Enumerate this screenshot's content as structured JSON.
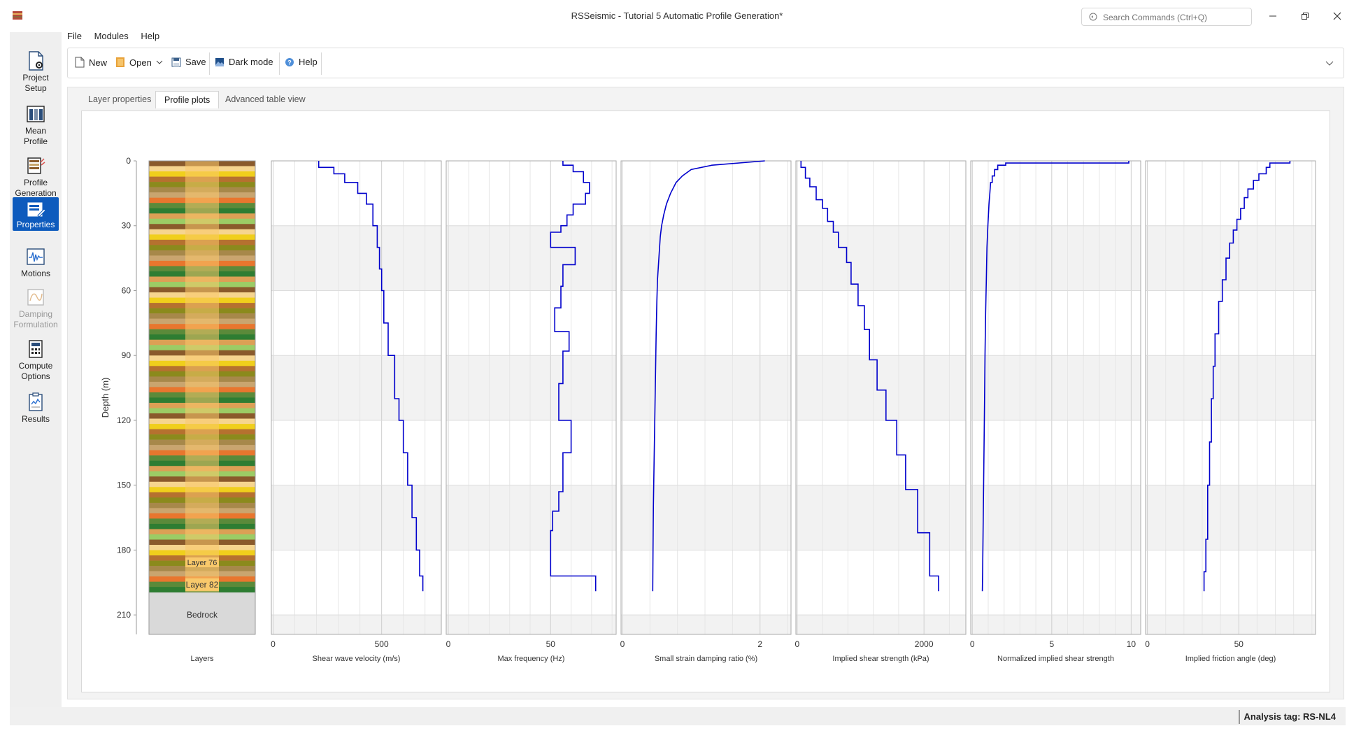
{
  "window": {
    "title": "RSSeismic - Tutorial 5 Automatic Profile Generation*"
  },
  "search": {
    "placeholder": "Search Commands (Ctrl+Q)"
  },
  "menu": [
    "File",
    "Modules",
    "Help"
  ],
  "toolbar": {
    "new_label": "New",
    "open_label": "Open",
    "save_label": "Save",
    "darkmode_label": "Dark mode",
    "help_label": "Help"
  },
  "sidebar": {
    "items": [
      {
        "line1": "Project",
        "line2": "Setup"
      },
      {
        "line1": "Mean",
        "line2": "Profile"
      },
      {
        "line1": "Profile",
        "line2": "Generation"
      },
      {
        "line1": "Properties",
        "line2": ""
      },
      {
        "line1": "Motions",
        "line2": ""
      },
      {
        "line1": "Damping",
        "line2": "Formulation"
      },
      {
        "line1": "Compute",
        "line2": "Options"
      },
      {
        "line1": "Results",
        "line2": ""
      }
    ]
  },
  "tabs": [
    "Layer properties",
    "Profile plots",
    "Advanced table view"
  ],
  "status": {
    "analysis_tag": "Analysis tag: RS-NL4"
  },
  "colors": {
    "accent": "#0e5bbd",
    "curve": "#0000cc",
    "band": "#f2f2f2",
    "bedrock": "#d9d9d9",
    "label_chip": "#f9c96b"
  },
  "chart_data": {
    "type": "line",
    "ylabel": "Depth (m)",
    "y_ticks": [
      0,
      30,
      60,
      90,
      120,
      150,
      180,
      210
    ],
    "ylim": [
      0,
      219
    ],
    "grid": true,
    "layers_panel": {
      "xlabel": "Layers",
      "visible_layer_labels": [
        "Layer 76",
        "Layer 82"
      ],
      "bedrock_label": "Bedrock",
      "bedrock_top_depth": 199.5,
      "layer_count": 82
    },
    "panels": [
      {
        "xlabel": "Shear wave velocity (m/s)",
        "xlim": [
          -8,
          775
        ],
        "x_ticks": [
          0,
          500
        ],
        "points": [
          [
            210,
            0
          ],
          [
            210,
            3
          ],
          [
            280,
            3
          ],
          [
            280,
            6
          ],
          [
            330,
            6
          ],
          [
            330,
            10
          ],
          [
            390,
            10
          ],
          [
            390,
            15
          ],
          [
            430,
            15
          ],
          [
            430,
            20
          ],
          [
            460,
            20
          ],
          [
            460,
            30
          ],
          [
            480,
            30
          ],
          [
            480,
            40
          ],
          [
            490,
            40
          ],
          [
            490,
            50
          ],
          [
            500,
            50
          ],
          [
            500,
            60
          ],
          [
            510,
            60
          ],
          [
            510,
            75
          ],
          [
            530,
            75
          ],
          [
            530,
            90
          ],
          [
            560,
            90
          ],
          [
            560,
            110
          ],
          [
            580,
            110
          ],
          [
            580,
            120
          ],
          [
            600,
            120
          ],
          [
            600,
            135
          ],
          [
            620,
            135
          ],
          [
            620,
            150
          ],
          [
            640,
            150
          ],
          [
            640,
            165
          ],
          [
            660,
            165
          ],
          [
            660,
            180
          ],
          [
            675,
            180
          ],
          [
            675,
            192
          ],
          [
            690,
            192
          ],
          [
            690,
            199
          ]
        ]
      },
      {
        "xlabel": "Max frequency (Hz)",
        "xlim": [
          -1,
          82
        ],
        "x_ticks": [
          0,
          50
        ],
        "points": [
          [
            56,
            0
          ],
          [
            56,
            2
          ],
          [
            61,
            2
          ],
          [
            61,
            5
          ],
          [
            66,
            5
          ],
          [
            66,
            10
          ],
          [
            69,
            10
          ],
          [
            69,
            15
          ],
          [
            67,
            15
          ],
          [
            67,
            20
          ],
          [
            61,
            20
          ],
          [
            61,
            25
          ],
          [
            58,
            25
          ],
          [
            58,
            30
          ],
          [
            55,
            30
          ],
          [
            55,
            33
          ],
          [
            50,
            33
          ],
          [
            50,
            40
          ],
          [
            62,
            40
          ],
          [
            62,
            48
          ],
          [
            56,
            48
          ],
          [
            56,
            58
          ],
          [
            55,
            58
          ],
          [
            55,
            68
          ],
          [
            52,
            68
          ],
          [
            52,
            79
          ],
          [
            59,
            79
          ],
          [
            59,
            88
          ],
          [
            56,
            88
          ],
          [
            56,
            103
          ],
          [
            54,
            103
          ],
          [
            54,
            120
          ],
          [
            60,
            120
          ],
          [
            60,
            135
          ],
          [
            56,
            135
          ],
          [
            56,
            153
          ],
          [
            54,
            153
          ],
          [
            54,
            162
          ],
          [
            51,
            162
          ],
          [
            51,
            171
          ],
          [
            50,
            171
          ],
          [
            50,
            192
          ],
          [
            72,
            192
          ],
          [
            72,
            199
          ]
        ]
      },
      {
        "xlabel": "Small strain damping ratio (%)",
        "xlim": [
          -0.02,
          2.45
        ],
        "x_ticks": [
          0,
          2
        ],
        "points": [
          [
            2.07,
            0
          ],
          [
            1.3,
            2
          ],
          [
            1.0,
            4
          ],
          [
            0.87,
            7
          ],
          [
            0.78,
            10
          ],
          [
            0.7,
            15
          ],
          [
            0.64,
            20
          ],
          [
            0.6,
            25
          ],
          [
            0.57,
            30
          ],
          [
            0.55,
            35
          ],
          [
            0.53,
            45
          ],
          [
            0.51,
            55
          ],
          [
            0.5,
            65
          ],
          [
            0.49,
            80
          ],
          [
            0.48,
            100
          ],
          [
            0.47,
            120
          ],
          [
            0.46,
            140
          ],
          [
            0.45,
            160
          ],
          [
            0.445,
            180
          ],
          [
            0.44,
            199
          ]
        ]
      },
      {
        "xlabel": "Implied shear strength (kPa)",
        "xlim": [
          -20,
          2660
        ],
        "x_ticks": [
          0,
          2000
        ],
        "points": [
          [
            60,
            0
          ],
          [
            60,
            3
          ],
          [
            130,
            3
          ],
          [
            130,
            8
          ],
          [
            200,
            8
          ],
          [
            200,
            12
          ],
          [
            300,
            12
          ],
          [
            300,
            18
          ],
          [
            400,
            18
          ],
          [
            400,
            22
          ],
          [
            480,
            22
          ],
          [
            480,
            28
          ],
          [
            570,
            28
          ],
          [
            570,
            33
          ],
          [
            650,
            33
          ],
          [
            650,
            40
          ],
          [
            780,
            40
          ],
          [
            780,
            47
          ],
          [
            850,
            47
          ],
          [
            850,
            57
          ],
          [
            960,
            57
          ],
          [
            960,
            67
          ],
          [
            1060,
            67
          ],
          [
            1060,
            78
          ],
          [
            1140,
            78
          ],
          [
            1140,
            92
          ],
          [
            1260,
            92
          ],
          [
            1260,
            106
          ],
          [
            1400,
            106
          ],
          [
            1400,
            120
          ],
          [
            1570,
            120
          ],
          [
            1570,
            136
          ],
          [
            1710,
            136
          ],
          [
            1710,
            152
          ],
          [
            1900,
            152
          ],
          [
            1900,
            172
          ],
          [
            2090,
            172
          ],
          [
            2090,
            192
          ],
          [
            2230,
            192
          ],
          [
            2230,
            199
          ]
        ]
      },
      {
        "xlabel": "Normalized implied shear strength",
        "xlim": [
          -0.1,
          10.6
        ],
        "x_ticks": [
          0,
          5,
          10
        ],
        "points": [
          [
            9.85,
            0
          ],
          [
            9.85,
            1
          ],
          [
            2.1,
            1
          ],
          [
            2.1,
            2
          ],
          [
            1.6,
            2
          ],
          [
            1.6,
            4
          ],
          [
            1.4,
            4
          ],
          [
            1.4,
            7
          ],
          [
            1.25,
            7
          ],
          [
            1.25,
            10
          ],
          [
            1.15,
            10
          ],
          [
            1.1,
            15
          ],
          [
            1.05,
            20
          ],
          [
            0.98,
            30
          ],
          [
            0.92,
            40
          ],
          [
            0.88,
            55
          ],
          [
            0.84,
            70
          ],
          [
            0.8,
            90
          ],
          [
            0.77,
            110
          ],
          [
            0.74,
            130
          ],
          [
            0.71,
            150
          ],
          [
            0.68,
            170
          ],
          [
            0.65,
            190
          ],
          [
            0.63,
            199
          ]
        ]
      },
      {
        "xlabel": "Implied friction angle (deg)",
        "xlim": [
          -1,
          92
        ],
        "x_ticks": [
          0,
          50
        ],
        "points": [
          [
            78,
            0
          ],
          [
            78,
            1
          ],
          [
            67,
            1
          ],
          [
            67,
            3
          ],
          [
            65,
            3
          ],
          [
            65,
            6
          ],
          [
            61,
            6
          ],
          [
            61,
            9
          ],
          [
            58,
            9
          ],
          [
            58,
            13
          ],
          [
            55,
            13
          ],
          [
            55,
            17
          ],
          [
            53,
            17
          ],
          [
            53,
            22
          ],
          [
            51,
            22
          ],
          [
            51,
            27
          ],
          [
            49,
            27
          ],
          [
            49,
            32
          ],
          [
            47,
            32
          ],
          [
            47,
            38
          ],
          [
            45,
            38
          ],
          [
            45,
            45
          ],
          [
            43,
            45
          ],
          [
            43,
            55
          ],
          [
            41,
            55
          ],
          [
            41,
            65
          ],
          [
            39,
            65
          ],
          [
            39,
            80
          ],
          [
            37,
            80
          ],
          [
            37,
            95
          ],
          [
            36,
            95
          ],
          [
            36,
            110
          ],
          [
            35,
            110
          ],
          [
            35,
            130
          ],
          [
            34,
            130
          ],
          [
            34,
            150
          ],
          [
            33,
            150
          ],
          [
            33,
            175
          ],
          [
            32,
            175
          ],
          [
            32,
            190
          ],
          [
            31,
            190
          ],
          [
            31,
            199
          ]
        ]
      }
    ]
  }
}
